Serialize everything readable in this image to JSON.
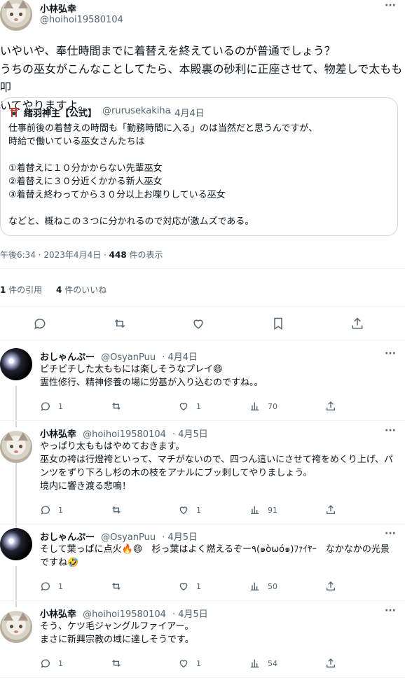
{
  "main_tweet": {
    "author_name": "小林弘幸",
    "author_handle": "@hoihoi19580104",
    "lines": [
      "いやいや、奉仕時間までに着替えを終えているのが普通でしょう？",
      "うちの巫女がこんなことしてたら、本殿裏の砂利に正座させて、物差しで太もも叩",
      "いてやりますよ。"
    ],
    "quote": {
      "author_name": "緒羽神主【公式】",
      "author_handle": "@rurusekakiha",
      "date": "· 4月4日",
      "lines": [
        "仕事前後の着替えの時間も「勤務時間に入る」のは当然だと思うんですが、",
        "時給で働いている巫女さんたちは",
        "",
        "①着替えに１０分かからない先輩巫女",
        "②着替えに３０分近くかかる新人巫女",
        "③着替え終わってから３０分以上お喋りしている巫女",
        "",
        "などと、概ねこの３つに分かれるので対応が激ムズである。"
      ]
    },
    "timestamp": "午後6:34 · 2023年4月4日 · ",
    "views_count": "448",
    "views_label": " 件の表示",
    "quotes_count": "1",
    "quotes_label": " 件の引用",
    "likes_count": "4",
    "likes_label": " 件のいいね"
  },
  "replies": [
    {
      "author_name": "おしゃんぷー",
      "author_handle": "@OsyanPuu",
      "date": "· 4月4日",
      "avatar": "moon",
      "lines": [
        "ピチピチした太ももには楽しそうなプレイ😄",
        "霊性修行、精神修養の場に労基が入り込むのですね。。"
      ],
      "replies": "1",
      "retweets": "",
      "likes": "1",
      "views": "70"
    },
    {
      "author_name": "小林弘幸",
      "author_handle": "@hoihoi19580104",
      "date": "· 4月5日",
      "avatar": "cat",
      "lines": [
        "やっぱり太ももはやめておきます。",
        "巫女の袴は行燈袴といって、マチがないので、四つん這いにさせて袴をめくり上げ、パ",
        "ンツをずり下ろし杉の木の枝をアナルにブッ刺してやりましょう。",
        "境内に響き渡る悲鳴！"
      ],
      "replies": "1",
      "retweets": "",
      "likes": "1",
      "views": "91"
    },
    {
      "author_name": "おしゃんぷー",
      "author_handle": "@OsyanPuu",
      "date": "· 4月5日",
      "avatar": "moon",
      "lines": [
        "そして葉っぱに点火🔥😄　杉っ葉はよく燃えるぞー٩(๑òωó๑)ﾌｧｲﾔｰ　なかなかの光景",
        "ですね🤣"
      ],
      "replies": "1",
      "retweets": "",
      "likes": "1",
      "views": "50"
    },
    {
      "author_name": "小林弘幸",
      "author_handle": "@hoihoi19580104",
      "date": "· 4月5日",
      "avatar": "cat",
      "lines": [
        "そう、ケツ毛ジャングルファイアー。",
        "まさに新興宗教の域に達しそうです。"
      ],
      "replies": "1",
      "retweets": "",
      "likes": "1",
      "views": "54"
    }
  ],
  "more_label": "···"
}
